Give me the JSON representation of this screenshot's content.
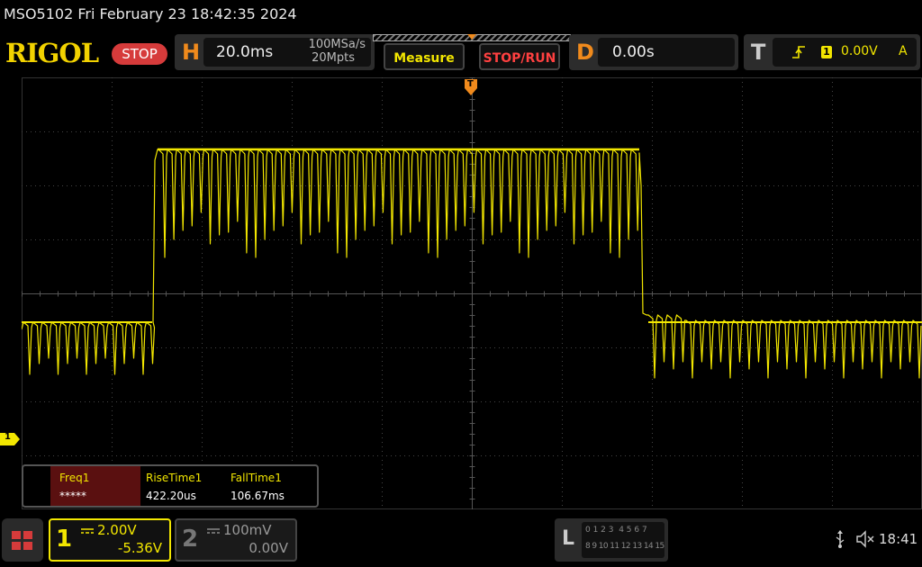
{
  "header": {
    "title": "MSO5102  Fri February 23 18:42:35 2024"
  },
  "toolbar": {
    "brand": "RIGOL",
    "run_state": "STOP",
    "horizontal": {
      "letter": "H",
      "timebase": "20.0ms",
      "sample_rate": "100MSa/s",
      "memory_depth": "20Mpts"
    },
    "measure_label": "Measure",
    "stoprun_label": "STOP/RUN",
    "delay": {
      "letter": "D",
      "value": "0.00s"
    },
    "trigger": {
      "letter": "T",
      "channel": "1",
      "level": "0.00V",
      "mode": "A"
    }
  },
  "screen": {
    "trigger_marker": "T",
    "ch1_ground_marker": "1",
    "trace_color": "#f2e600"
  },
  "measurements": {
    "items": [
      {
        "label": "Freq1",
        "value": "*****"
      },
      {
        "label": "RiseTime1",
        "value": "422.20us"
      },
      {
        "label": "FallTime1",
        "value": "106.67ms"
      }
    ]
  },
  "footer": {
    "ch1": {
      "num": "1",
      "scale": "2.00V",
      "offset": "-5.36V"
    },
    "ch2": {
      "num": "2",
      "scale": "100mV",
      "offset": "0.00V"
    },
    "logic": {
      "letter": "L",
      "row1": "0 1 2 3  4 5 6 7",
      "row2": "8 9 10 11 12 13 14 15"
    },
    "time": "18:41"
  },
  "colors": {
    "ch1": "#f2e600",
    "accent_orange": "#f08a1c",
    "stop_red": "#d63b3b",
    "grid": "#444"
  }
}
